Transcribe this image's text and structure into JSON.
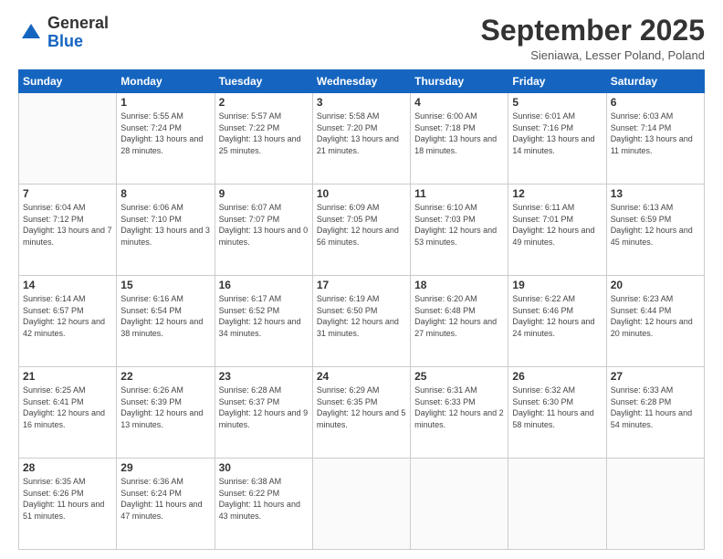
{
  "logo": {
    "general": "General",
    "blue": "Blue"
  },
  "header": {
    "month": "September 2025",
    "location": "Sieniawa, Lesser Poland, Poland"
  },
  "days_of_week": [
    "Sunday",
    "Monday",
    "Tuesday",
    "Wednesday",
    "Thursday",
    "Friday",
    "Saturday"
  ],
  "weeks": [
    [
      {
        "day": "",
        "sunrise": "",
        "sunset": "",
        "daylight": ""
      },
      {
        "day": "1",
        "sunrise": "Sunrise: 5:55 AM",
        "sunset": "Sunset: 7:24 PM",
        "daylight": "Daylight: 13 hours and 28 minutes."
      },
      {
        "day": "2",
        "sunrise": "Sunrise: 5:57 AM",
        "sunset": "Sunset: 7:22 PM",
        "daylight": "Daylight: 13 hours and 25 minutes."
      },
      {
        "day": "3",
        "sunrise": "Sunrise: 5:58 AM",
        "sunset": "Sunset: 7:20 PM",
        "daylight": "Daylight: 13 hours and 21 minutes."
      },
      {
        "day": "4",
        "sunrise": "Sunrise: 6:00 AM",
        "sunset": "Sunset: 7:18 PM",
        "daylight": "Daylight: 13 hours and 18 minutes."
      },
      {
        "day": "5",
        "sunrise": "Sunrise: 6:01 AM",
        "sunset": "Sunset: 7:16 PM",
        "daylight": "Daylight: 13 hours and 14 minutes."
      },
      {
        "day": "6",
        "sunrise": "Sunrise: 6:03 AM",
        "sunset": "Sunset: 7:14 PM",
        "daylight": "Daylight: 13 hours and 11 minutes."
      }
    ],
    [
      {
        "day": "7",
        "sunrise": "Sunrise: 6:04 AM",
        "sunset": "Sunset: 7:12 PM",
        "daylight": "Daylight: 13 hours and 7 minutes."
      },
      {
        "day": "8",
        "sunrise": "Sunrise: 6:06 AM",
        "sunset": "Sunset: 7:10 PM",
        "daylight": "Daylight: 13 hours and 3 minutes."
      },
      {
        "day": "9",
        "sunrise": "Sunrise: 6:07 AM",
        "sunset": "Sunset: 7:07 PM",
        "daylight": "Daylight: 13 hours and 0 minutes."
      },
      {
        "day": "10",
        "sunrise": "Sunrise: 6:09 AM",
        "sunset": "Sunset: 7:05 PM",
        "daylight": "Daylight: 12 hours and 56 minutes."
      },
      {
        "day": "11",
        "sunrise": "Sunrise: 6:10 AM",
        "sunset": "Sunset: 7:03 PM",
        "daylight": "Daylight: 12 hours and 53 minutes."
      },
      {
        "day": "12",
        "sunrise": "Sunrise: 6:11 AM",
        "sunset": "Sunset: 7:01 PM",
        "daylight": "Daylight: 12 hours and 49 minutes."
      },
      {
        "day": "13",
        "sunrise": "Sunrise: 6:13 AM",
        "sunset": "Sunset: 6:59 PM",
        "daylight": "Daylight: 12 hours and 45 minutes."
      }
    ],
    [
      {
        "day": "14",
        "sunrise": "Sunrise: 6:14 AM",
        "sunset": "Sunset: 6:57 PM",
        "daylight": "Daylight: 12 hours and 42 minutes."
      },
      {
        "day": "15",
        "sunrise": "Sunrise: 6:16 AM",
        "sunset": "Sunset: 6:54 PM",
        "daylight": "Daylight: 12 hours and 38 minutes."
      },
      {
        "day": "16",
        "sunrise": "Sunrise: 6:17 AM",
        "sunset": "Sunset: 6:52 PM",
        "daylight": "Daylight: 12 hours and 34 minutes."
      },
      {
        "day": "17",
        "sunrise": "Sunrise: 6:19 AM",
        "sunset": "Sunset: 6:50 PM",
        "daylight": "Daylight: 12 hours and 31 minutes."
      },
      {
        "day": "18",
        "sunrise": "Sunrise: 6:20 AM",
        "sunset": "Sunset: 6:48 PM",
        "daylight": "Daylight: 12 hours and 27 minutes."
      },
      {
        "day": "19",
        "sunrise": "Sunrise: 6:22 AM",
        "sunset": "Sunset: 6:46 PM",
        "daylight": "Daylight: 12 hours and 24 minutes."
      },
      {
        "day": "20",
        "sunrise": "Sunrise: 6:23 AM",
        "sunset": "Sunset: 6:44 PM",
        "daylight": "Daylight: 12 hours and 20 minutes."
      }
    ],
    [
      {
        "day": "21",
        "sunrise": "Sunrise: 6:25 AM",
        "sunset": "Sunset: 6:41 PM",
        "daylight": "Daylight: 12 hours and 16 minutes."
      },
      {
        "day": "22",
        "sunrise": "Sunrise: 6:26 AM",
        "sunset": "Sunset: 6:39 PM",
        "daylight": "Daylight: 12 hours and 13 minutes."
      },
      {
        "day": "23",
        "sunrise": "Sunrise: 6:28 AM",
        "sunset": "Sunset: 6:37 PM",
        "daylight": "Daylight: 12 hours and 9 minutes."
      },
      {
        "day": "24",
        "sunrise": "Sunrise: 6:29 AM",
        "sunset": "Sunset: 6:35 PM",
        "daylight": "Daylight: 12 hours and 5 minutes."
      },
      {
        "day": "25",
        "sunrise": "Sunrise: 6:31 AM",
        "sunset": "Sunset: 6:33 PM",
        "daylight": "Daylight: 12 hours and 2 minutes."
      },
      {
        "day": "26",
        "sunrise": "Sunrise: 6:32 AM",
        "sunset": "Sunset: 6:30 PM",
        "daylight": "Daylight: 11 hours and 58 minutes."
      },
      {
        "day": "27",
        "sunrise": "Sunrise: 6:33 AM",
        "sunset": "Sunset: 6:28 PM",
        "daylight": "Daylight: 11 hours and 54 minutes."
      }
    ],
    [
      {
        "day": "28",
        "sunrise": "Sunrise: 6:35 AM",
        "sunset": "Sunset: 6:26 PM",
        "daylight": "Daylight: 11 hours and 51 minutes."
      },
      {
        "day": "29",
        "sunrise": "Sunrise: 6:36 AM",
        "sunset": "Sunset: 6:24 PM",
        "daylight": "Daylight: 11 hours and 47 minutes."
      },
      {
        "day": "30",
        "sunrise": "Sunrise: 6:38 AM",
        "sunset": "Sunset: 6:22 PM",
        "daylight": "Daylight: 11 hours and 43 minutes."
      },
      {
        "day": "",
        "sunrise": "",
        "sunset": "",
        "daylight": ""
      },
      {
        "day": "",
        "sunrise": "",
        "sunset": "",
        "daylight": ""
      },
      {
        "day": "",
        "sunrise": "",
        "sunset": "",
        "daylight": ""
      },
      {
        "day": "",
        "sunrise": "",
        "sunset": "",
        "daylight": ""
      }
    ]
  ]
}
